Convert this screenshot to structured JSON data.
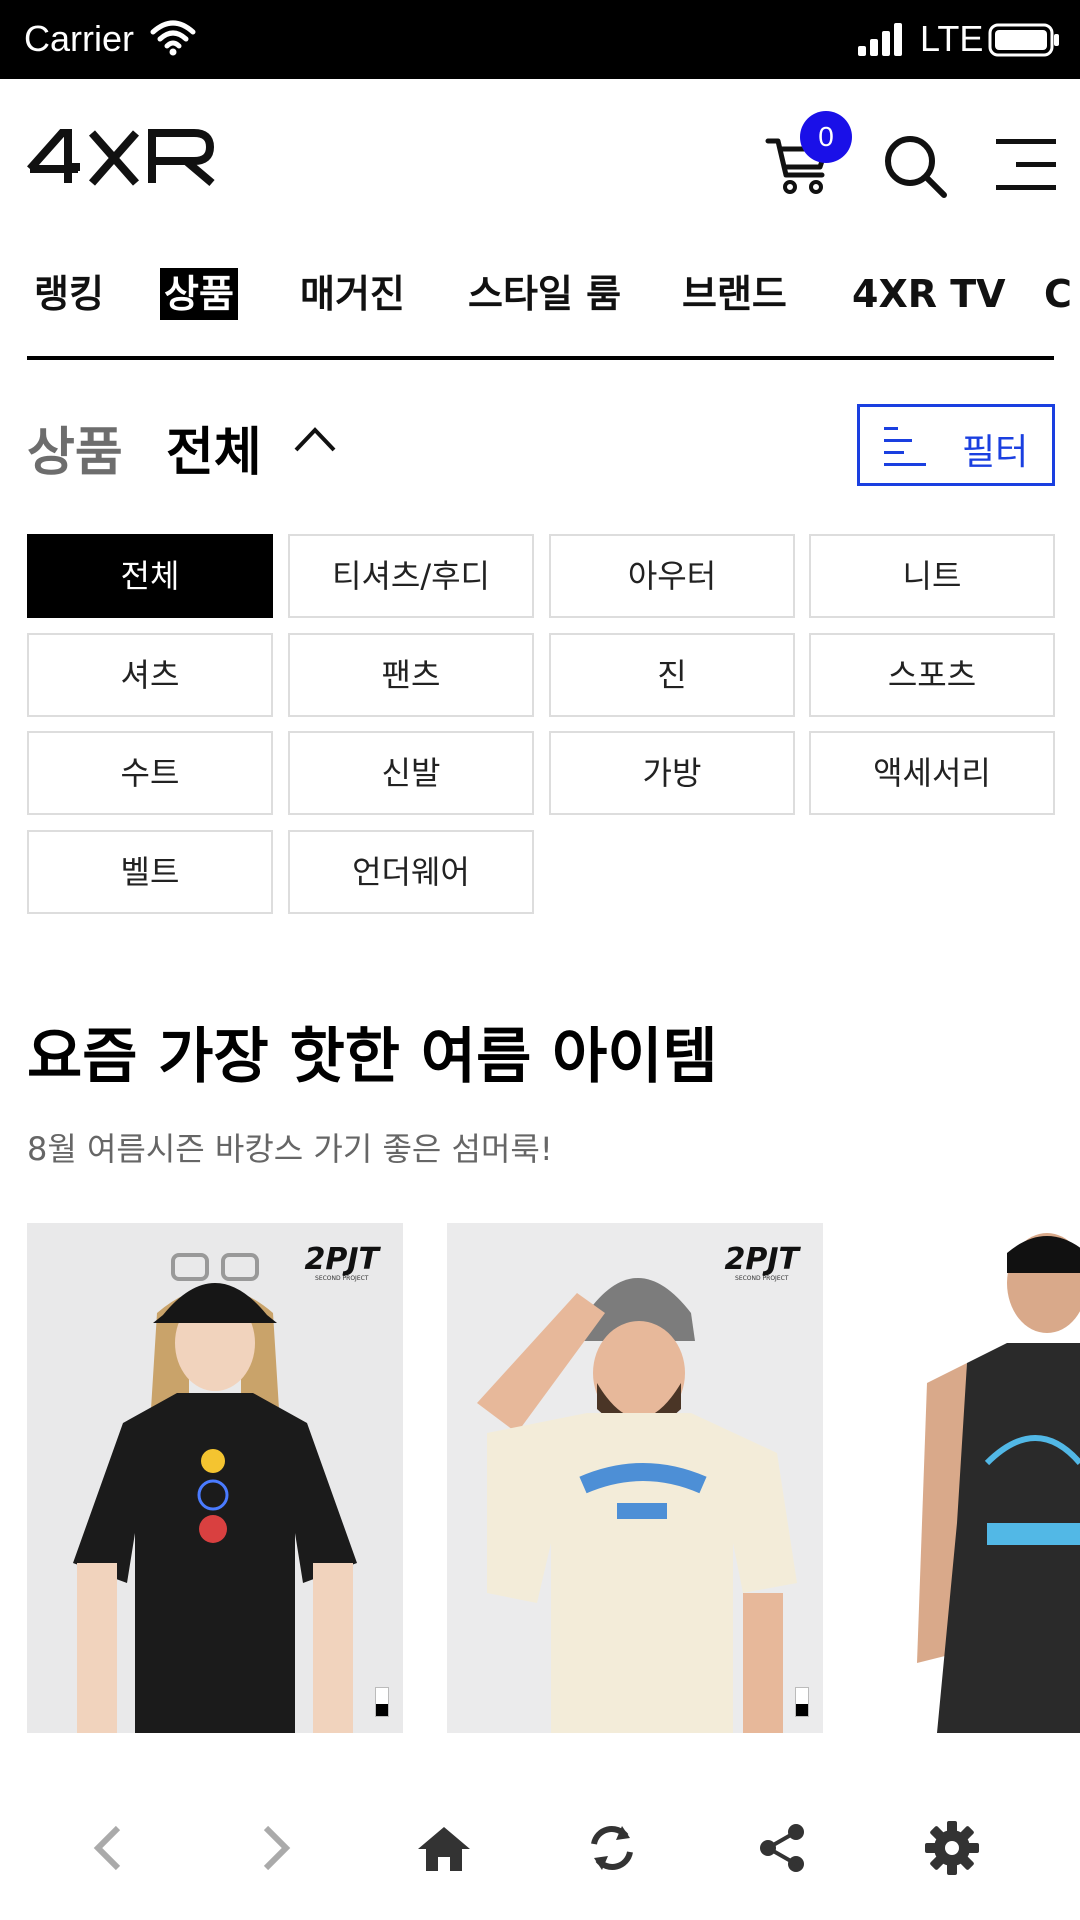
{
  "status_bar": {
    "carrier": "Carrier",
    "network": "LTE",
    "icons": [
      "wifi-icon",
      "signal-icon",
      "battery-icon"
    ]
  },
  "header": {
    "logo_text": "4XR",
    "cart_count": "0",
    "icons": [
      "cart-icon",
      "search-icon",
      "menu-icon"
    ],
    "accent_color": "#1a10e8"
  },
  "nav": {
    "items": [
      {
        "label": "랭킹"
      },
      {
        "label": "상품"
      },
      {
        "label": "매거진"
      },
      {
        "label": "스타일 룸"
      },
      {
        "label": "브랜드"
      },
      {
        "label": "4XR TV"
      },
      {
        "label": "C"
      }
    ],
    "active_index": 1
  },
  "page_title": {
    "prefix": "상품",
    "main": "전체",
    "filter_label": "필터",
    "filter_color": "#1a3fe0"
  },
  "categories": [
    {
      "label": "전체"
    },
    {
      "label": "티셔츠/후디"
    },
    {
      "label": "아우터"
    },
    {
      "label": "니트"
    },
    {
      "label": "셔츠"
    },
    {
      "label": "팬츠"
    },
    {
      "label": "진"
    },
    {
      "label": "스포츠"
    },
    {
      "label": "수트"
    },
    {
      "label": "신발"
    },
    {
      "label": "가방"
    },
    {
      "label": "액세서리"
    },
    {
      "label": "벨트"
    },
    {
      "label": "언더웨어"
    }
  ],
  "section": {
    "title": "요즘 가장 핫한 여름 아이템",
    "subtitle": "8월 여름시즌 바캉스 가기 좋은 섬머룩!"
  },
  "products": [
    {
      "brand": "2PJT",
      "brand_sub": "SECOND PROJECT",
      "shirt_color": "#1b1b1b"
    },
    {
      "brand": "2PJT",
      "brand_sub": "SECOND PROJECT",
      "shirt_color": "#f3ecd9"
    },
    {
      "brand": "",
      "brand_sub": "",
      "shirt_color": "#2a2a2a"
    }
  ],
  "toolbar": {
    "icons": [
      "back-icon",
      "forward-icon",
      "home-icon",
      "refresh-icon",
      "share-icon",
      "settings-icon"
    ]
  }
}
